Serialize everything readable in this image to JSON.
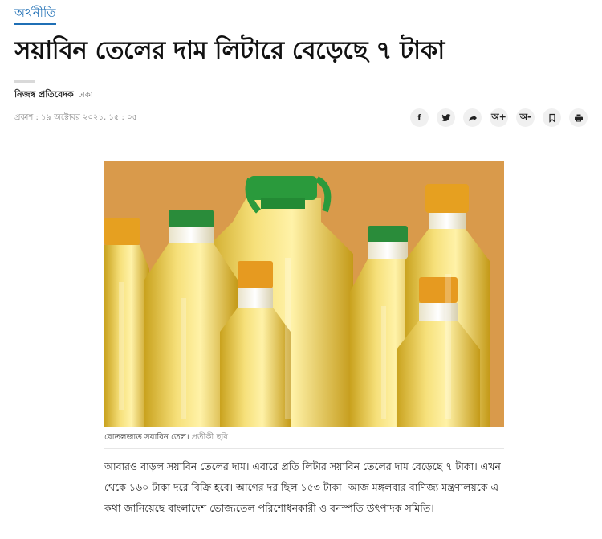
{
  "article": {
    "category": "অর্থনীতি",
    "headline": "সয়াবিন তেলের দাম লিটারে বেড়েছে ৭ টাকা",
    "author": "নিজস্ব প্রতিবেদক",
    "location": "ঢাকা",
    "published": "প্রকাশ : ১৯ অক্টোবর ২০২১, ১৫ : ০৫",
    "photo_caption": "বোতলজাত সয়াবিন তেল।",
    "photo_credit": "প্রতীকী ছবি",
    "body": "আবারও বাড়ল সয়াবিন তেলের দাম। এবারে প্রতি লিটার সয়াবিন তেলের দাম বেড়েছে ৭ টাকা। এখন থেকে ১৬০ টাকা দরে বিক্রি হবে। আগের দর ছিল ১৫৩ টাকা। আজ মঙ্গলবার বাণিজ্য মন্ত্রণালয়কে এ কথা জানিয়েছে বাংলাদেশ ভোজ্যতেল পরিশোধনকারী ও বনস্পতি উৎপাদক সমিতি।"
  },
  "share": {
    "facebook": "f",
    "font_increase": "অ+",
    "font_decrease": "অ-"
  },
  "icons": [
    "facebook-icon",
    "twitter-icon",
    "share-icon",
    "font-increase-icon",
    "font-decrease-icon",
    "bookmark-icon",
    "print-icon"
  ],
  "colors": {
    "category_link": "#1f6fb5",
    "photo_background": "#d99a4b"
  }
}
